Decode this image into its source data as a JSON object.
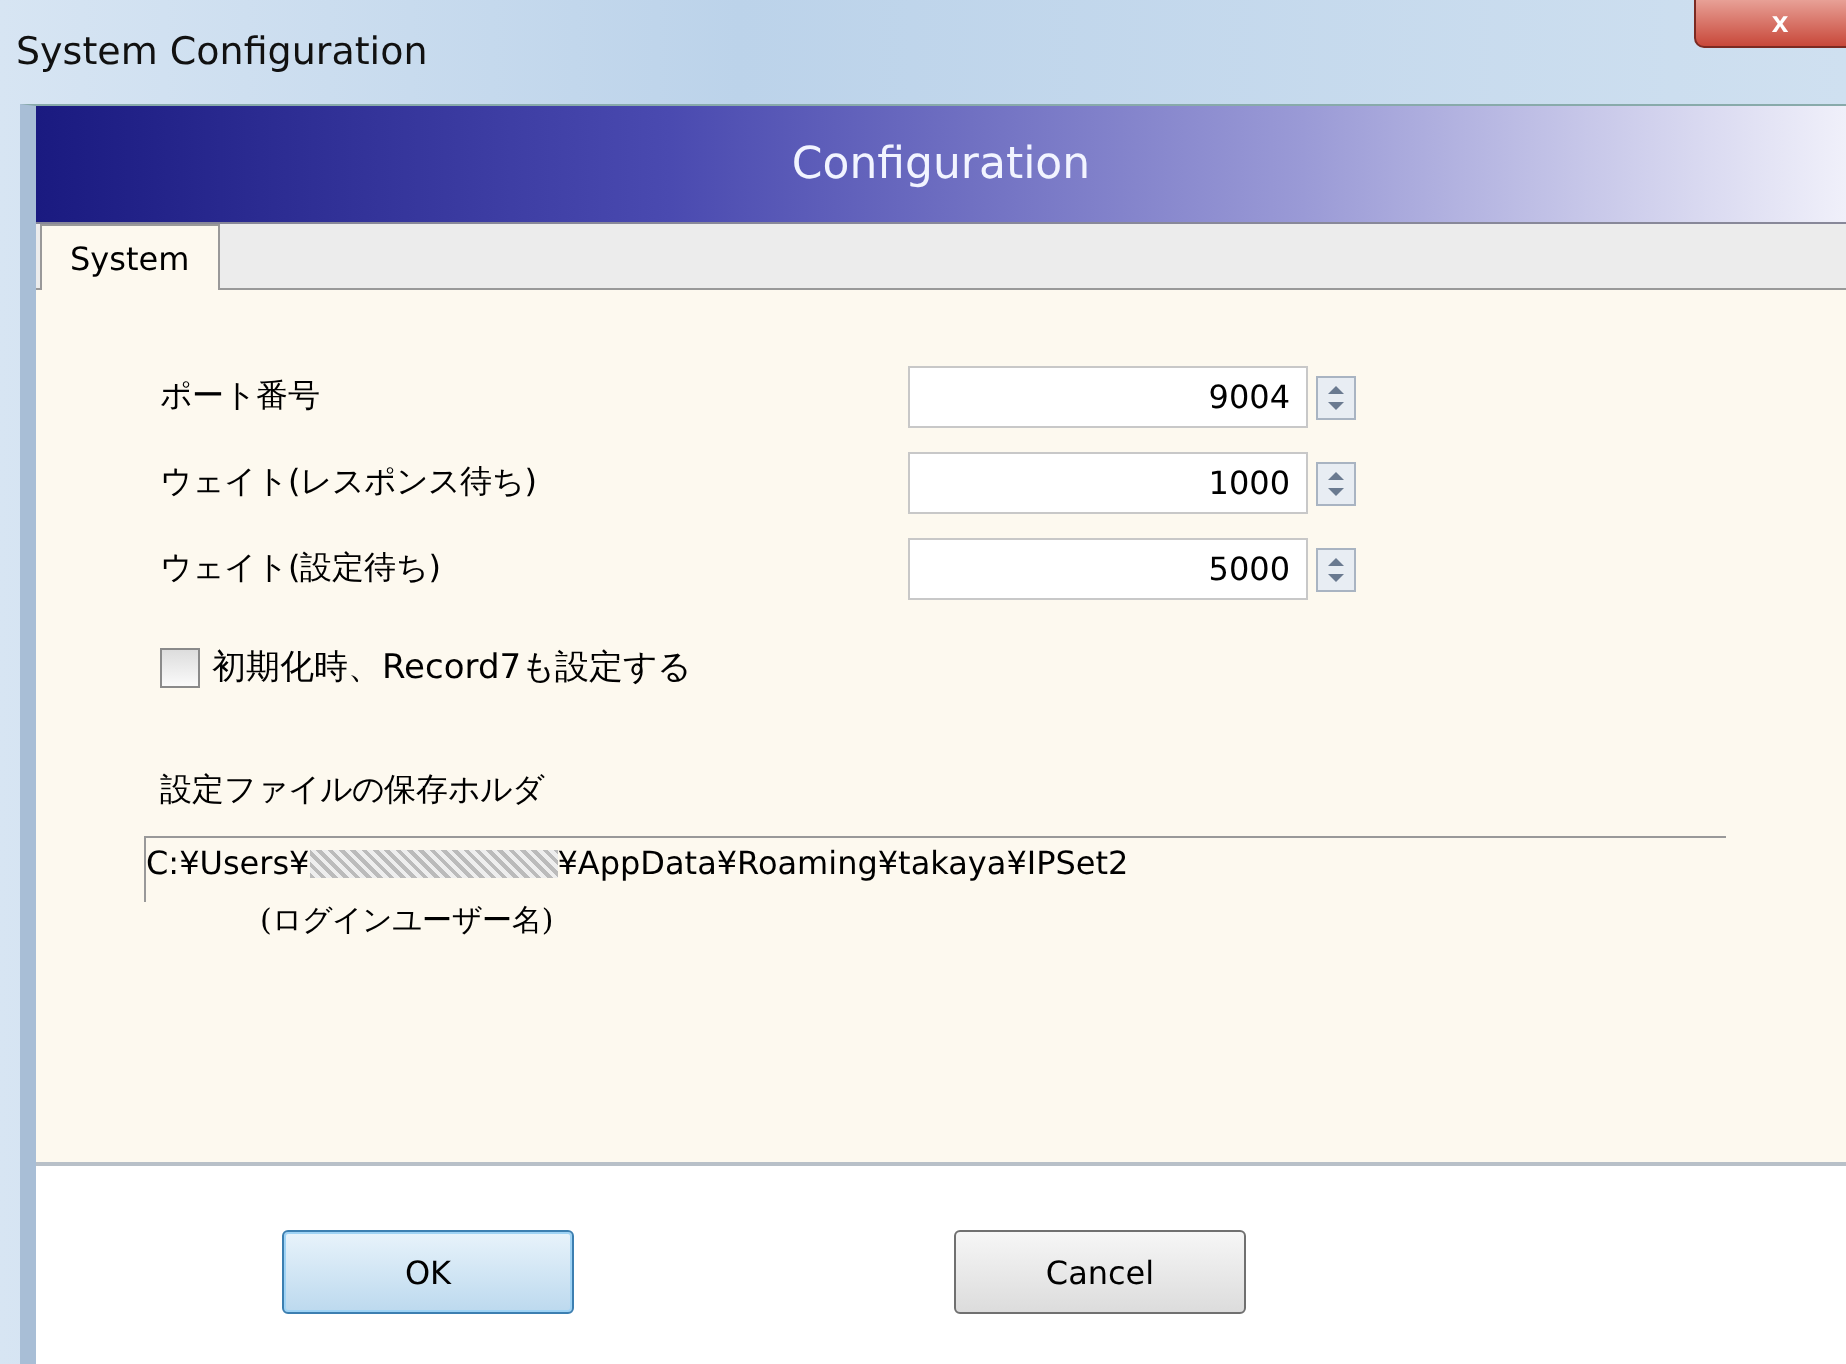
{
  "window": {
    "title": "System Configuration",
    "close": "x"
  },
  "header": "Configuration",
  "tabs": [
    {
      "label": "System",
      "selected": true
    }
  ],
  "fields": [
    {
      "label": "ポート番号",
      "value": "9004"
    },
    {
      "label": "ウェイト(レスポンス待ち)",
      "value": "1000"
    },
    {
      "label": "ウェイト(設定待ち)",
      "value": "5000"
    }
  ],
  "checkbox": {
    "label": "初期化時、Record7も設定する",
    "checked": false
  },
  "folder": {
    "label": "設定ファイルの保存ホルダ",
    "path_prefix": "C:¥Users¥",
    "path_suffix": "¥AppData¥Roaming¥takaya¥IPSet2",
    "note": "(ログインユーザー名)"
  },
  "buttons": [
    {
      "label": "OK",
      "selected": true
    },
    {
      "label": "Cancel",
      "selected": false
    }
  ]
}
